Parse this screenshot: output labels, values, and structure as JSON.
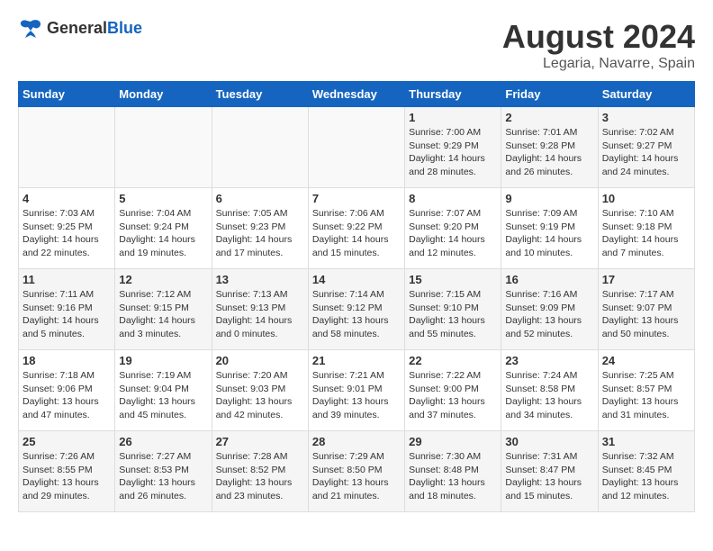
{
  "logo": {
    "general": "General",
    "blue": "Blue"
  },
  "header": {
    "title": "August 2024",
    "subtitle": "Legaria, Navarre, Spain"
  },
  "weekdays": [
    "Sunday",
    "Monday",
    "Tuesday",
    "Wednesday",
    "Thursday",
    "Friday",
    "Saturday"
  ],
  "weeks": [
    [
      {
        "day": "",
        "info": ""
      },
      {
        "day": "",
        "info": ""
      },
      {
        "day": "",
        "info": ""
      },
      {
        "day": "",
        "info": ""
      },
      {
        "day": "1",
        "info": "Sunrise: 7:00 AM\nSunset: 9:29 PM\nDaylight: 14 hours\nand 28 minutes."
      },
      {
        "day": "2",
        "info": "Sunrise: 7:01 AM\nSunset: 9:28 PM\nDaylight: 14 hours\nand 26 minutes."
      },
      {
        "day": "3",
        "info": "Sunrise: 7:02 AM\nSunset: 9:27 PM\nDaylight: 14 hours\nand 24 minutes."
      }
    ],
    [
      {
        "day": "4",
        "info": "Sunrise: 7:03 AM\nSunset: 9:25 PM\nDaylight: 14 hours\nand 22 minutes."
      },
      {
        "day": "5",
        "info": "Sunrise: 7:04 AM\nSunset: 9:24 PM\nDaylight: 14 hours\nand 19 minutes."
      },
      {
        "day": "6",
        "info": "Sunrise: 7:05 AM\nSunset: 9:23 PM\nDaylight: 14 hours\nand 17 minutes."
      },
      {
        "day": "7",
        "info": "Sunrise: 7:06 AM\nSunset: 9:22 PM\nDaylight: 14 hours\nand 15 minutes."
      },
      {
        "day": "8",
        "info": "Sunrise: 7:07 AM\nSunset: 9:20 PM\nDaylight: 14 hours\nand 12 minutes."
      },
      {
        "day": "9",
        "info": "Sunrise: 7:09 AM\nSunset: 9:19 PM\nDaylight: 14 hours\nand 10 minutes."
      },
      {
        "day": "10",
        "info": "Sunrise: 7:10 AM\nSunset: 9:18 PM\nDaylight: 14 hours\nand 7 minutes."
      }
    ],
    [
      {
        "day": "11",
        "info": "Sunrise: 7:11 AM\nSunset: 9:16 PM\nDaylight: 14 hours\nand 5 minutes."
      },
      {
        "day": "12",
        "info": "Sunrise: 7:12 AM\nSunset: 9:15 PM\nDaylight: 14 hours\nand 3 minutes."
      },
      {
        "day": "13",
        "info": "Sunrise: 7:13 AM\nSunset: 9:13 PM\nDaylight: 14 hours\nand 0 minutes."
      },
      {
        "day": "14",
        "info": "Sunrise: 7:14 AM\nSunset: 9:12 PM\nDaylight: 13 hours\nand 58 minutes."
      },
      {
        "day": "15",
        "info": "Sunrise: 7:15 AM\nSunset: 9:10 PM\nDaylight: 13 hours\nand 55 minutes."
      },
      {
        "day": "16",
        "info": "Sunrise: 7:16 AM\nSunset: 9:09 PM\nDaylight: 13 hours\nand 52 minutes."
      },
      {
        "day": "17",
        "info": "Sunrise: 7:17 AM\nSunset: 9:07 PM\nDaylight: 13 hours\nand 50 minutes."
      }
    ],
    [
      {
        "day": "18",
        "info": "Sunrise: 7:18 AM\nSunset: 9:06 PM\nDaylight: 13 hours\nand 47 minutes."
      },
      {
        "day": "19",
        "info": "Sunrise: 7:19 AM\nSunset: 9:04 PM\nDaylight: 13 hours\nand 45 minutes."
      },
      {
        "day": "20",
        "info": "Sunrise: 7:20 AM\nSunset: 9:03 PM\nDaylight: 13 hours\nand 42 minutes."
      },
      {
        "day": "21",
        "info": "Sunrise: 7:21 AM\nSunset: 9:01 PM\nDaylight: 13 hours\nand 39 minutes."
      },
      {
        "day": "22",
        "info": "Sunrise: 7:22 AM\nSunset: 9:00 PM\nDaylight: 13 hours\nand 37 minutes."
      },
      {
        "day": "23",
        "info": "Sunrise: 7:24 AM\nSunset: 8:58 PM\nDaylight: 13 hours\nand 34 minutes."
      },
      {
        "day": "24",
        "info": "Sunrise: 7:25 AM\nSunset: 8:57 PM\nDaylight: 13 hours\nand 31 minutes."
      }
    ],
    [
      {
        "day": "25",
        "info": "Sunrise: 7:26 AM\nSunset: 8:55 PM\nDaylight: 13 hours\nand 29 minutes."
      },
      {
        "day": "26",
        "info": "Sunrise: 7:27 AM\nSunset: 8:53 PM\nDaylight: 13 hours\nand 26 minutes."
      },
      {
        "day": "27",
        "info": "Sunrise: 7:28 AM\nSunset: 8:52 PM\nDaylight: 13 hours\nand 23 minutes."
      },
      {
        "day": "28",
        "info": "Sunrise: 7:29 AM\nSunset: 8:50 PM\nDaylight: 13 hours\nand 21 minutes."
      },
      {
        "day": "29",
        "info": "Sunrise: 7:30 AM\nSunset: 8:48 PM\nDaylight: 13 hours\nand 18 minutes."
      },
      {
        "day": "30",
        "info": "Sunrise: 7:31 AM\nSunset: 8:47 PM\nDaylight: 13 hours\nand 15 minutes."
      },
      {
        "day": "31",
        "info": "Sunrise: 7:32 AM\nSunset: 8:45 PM\nDaylight: 13 hours\nand 12 minutes."
      }
    ]
  ]
}
